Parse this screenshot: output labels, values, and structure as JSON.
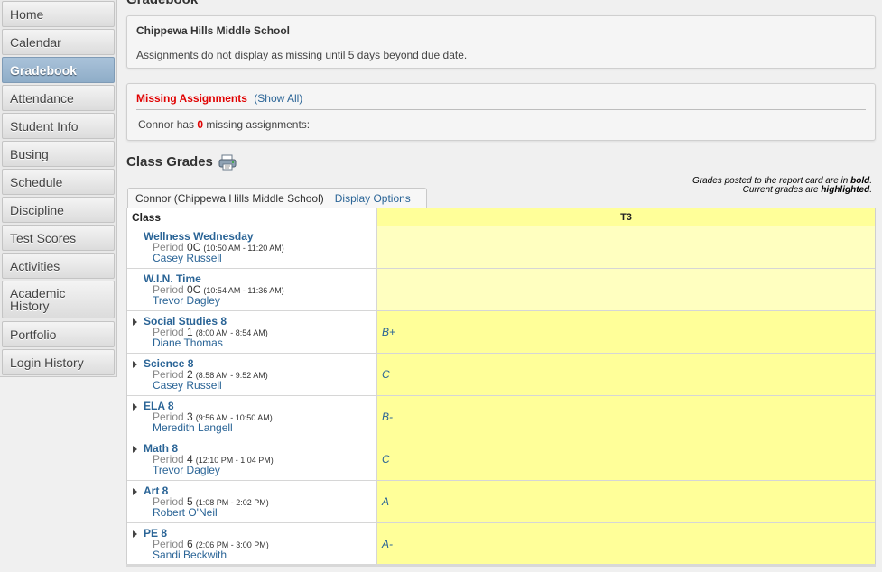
{
  "sidebar": {
    "items": [
      {
        "label": "Home",
        "active": false
      },
      {
        "label": "Calendar",
        "active": false
      },
      {
        "label": "Gradebook",
        "active": true
      },
      {
        "label": "Attendance",
        "active": false
      },
      {
        "label": "Student Info",
        "active": false
      },
      {
        "label": "Busing",
        "active": false
      },
      {
        "label": "Schedule",
        "active": false
      },
      {
        "label": "Discipline",
        "active": false
      },
      {
        "label": "Test Scores",
        "active": false
      },
      {
        "label": "Activities",
        "active": false
      },
      {
        "label": "Academic History",
        "active": false
      },
      {
        "label": "Portfolio",
        "active": false
      },
      {
        "label": "Login History",
        "active": false
      }
    ]
  },
  "page": {
    "title": "Gradebook"
  },
  "school_panel": {
    "school": "Chippewa Hills Middle School",
    "note": "Assignments do not display as missing until 5 days beyond due date."
  },
  "missing_panel": {
    "title": "Missing Assignments",
    "show_all": "(Show All)",
    "prefix": "Connor has",
    "count": "0",
    "suffix": "missing assignments:"
  },
  "class_grades": {
    "heading": "Class Grades",
    "print_icon": "printer-icon",
    "legend_line1_pre": "Grades posted to the report card are in",
    "legend_line1_em": "bold",
    "legend_line2_pre": "Current grades are",
    "legend_line2_em": "highlighted",
    "student_tab": "Connor (Chippewa Hills Middle School)",
    "display_options": "Display Options",
    "col_class": "Class",
    "col_term": "T3",
    "rows": [
      {
        "name": "Wellness Wednesday",
        "period_label": "Period",
        "period": "0C",
        "time": "(10:50 AM - 11:20 AM)",
        "teacher": "Casey Russell",
        "grade": "",
        "expandable": false
      },
      {
        "name": "W.I.N. Time",
        "period_label": "Period",
        "period": "0C",
        "time": "(10:54 AM - 11:36 AM)",
        "teacher": "Trevor Dagley",
        "grade": "",
        "expandable": false
      },
      {
        "name": "Social Studies 8",
        "period_label": "Period",
        "period": "1",
        "time": "(8:00 AM - 8:54 AM)",
        "teacher": "Diane Thomas",
        "grade": "B+",
        "expandable": true
      },
      {
        "name": "Science 8",
        "period_label": "Period",
        "period": "2",
        "time": "(8:58 AM - 9:52 AM)",
        "teacher": "Casey Russell",
        "grade": "C",
        "expandable": true
      },
      {
        "name": "ELA 8",
        "period_label": "Period",
        "period": "3",
        "time": "(9:56 AM - 10:50 AM)",
        "teacher": "Meredith Langell",
        "grade": "B-",
        "expandable": true
      },
      {
        "name": "Math 8",
        "period_label": "Period",
        "period": "4",
        "time": "(12:10 PM - 1:04 PM)",
        "teacher": "Trevor Dagley",
        "grade": "C",
        "expandable": true
      },
      {
        "name": "Art 8",
        "period_label": "Period",
        "period": "5",
        "time": "(1:08 PM - 2:02 PM)",
        "teacher": "Robert O'Neil",
        "grade": "A",
        "expandable": true
      },
      {
        "name": "PE 8",
        "period_label": "Period",
        "period": "6",
        "time": "(2:06 PM - 3:00 PM)",
        "teacher": "Sandi Beckwith",
        "grade": "A-",
        "expandable": true
      }
    ]
  },
  "colors": {
    "highlight": "#ffff99",
    "link": "#2a6496",
    "missing": "#e00000",
    "nav_active": "#9ab6cf"
  }
}
